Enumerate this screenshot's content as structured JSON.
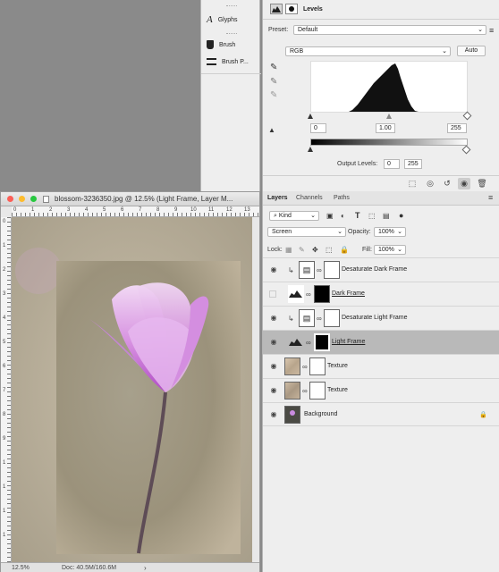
{
  "mini_panel": {
    "items": [
      {
        "label": "Glyphs",
        "icon": "glyphs-icon"
      },
      {
        "label": "Brush",
        "icon": "brush-icon"
      },
      {
        "label": "Brush P...",
        "icon": "brush-presets-icon"
      }
    ]
  },
  "properties": {
    "title": "Levels",
    "preset_label": "Preset:",
    "preset_value": "Default",
    "channel_value": "RGB",
    "auto_label": "Auto",
    "input_black": "0",
    "input_gamma": "1.00",
    "input_white": "255",
    "output_label": "Output Levels:",
    "output_black": "0",
    "output_white": "255"
  },
  "layers_panel": {
    "tabs": [
      "Layers",
      "Channels",
      "Paths"
    ],
    "filter_kind": "Kind",
    "blend_mode": "Screen",
    "opacity_label": "Opacity:",
    "opacity_value": "100%",
    "lock_label": "Lock:",
    "fill_label": "Fill:",
    "fill_value": "100%",
    "layers": [
      {
        "name": "Desaturate Dark Frame",
        "visible": true,
        "type": "adjustment",
        "clipped": true,
        "selected": false
      },
      {
        "name": "Dark Frame",
        "visible": false,
        "type": "levels",
        "clipped": false,
        "selected": false
      },
      {
        "name": "Desaturate Light Frame",
        "visible": true,
        "type": "adjustment",
        "clipped": true,
        "selected": false
      },
      {
        "name": "Light Frame",
        "visible": true,
        "type": "levels",
        "clipped": false,
        "selected": true
      },
      {
        "name": "Texture",
        "visible": true,
        "type": "image",
        "clipped": false,
        "selected": false
      },
      {
        "name": "Texture",
        "visible": true,
        "type": "image",
        "clipped": false,
        "selected": false
      },
      {
        "name": "Background",
        "visible": true,
        "type": "background",
        "clipped": false,
        "selected": false
      }
    ]
  },
  "document": {
    "title": "blossom-3236350.jpg @ 12.5% (Light Frame, Layer M...",
    "zoom": "12.5%",
    "doc_info": "Doc: 40.5M/160.6M",
    "ruler_top": [
      "0",
      "1",
      "2",
      "3",
      "4",
      "5",
      "6",
      "7",
      "8",
      "9",
      "10",
      "11",
      "12",
      "13"
    ],
    "ruler_left": [
      "0",
      "1",
      "2",
      "3",
      "4",
      "5",
      "6",
      "7",
      "8",
      "9",
      "1",
      "1",
      "1",
      "1"
    ]
  },
  "colors": {
    "panel_bg": "#eeeeee",
    "selected_row": "#b9b9b9",
    "close": "#fc5f57",
    "minimize": "#fdbc2e",
    "zoom": "#28c840"
  }
}
